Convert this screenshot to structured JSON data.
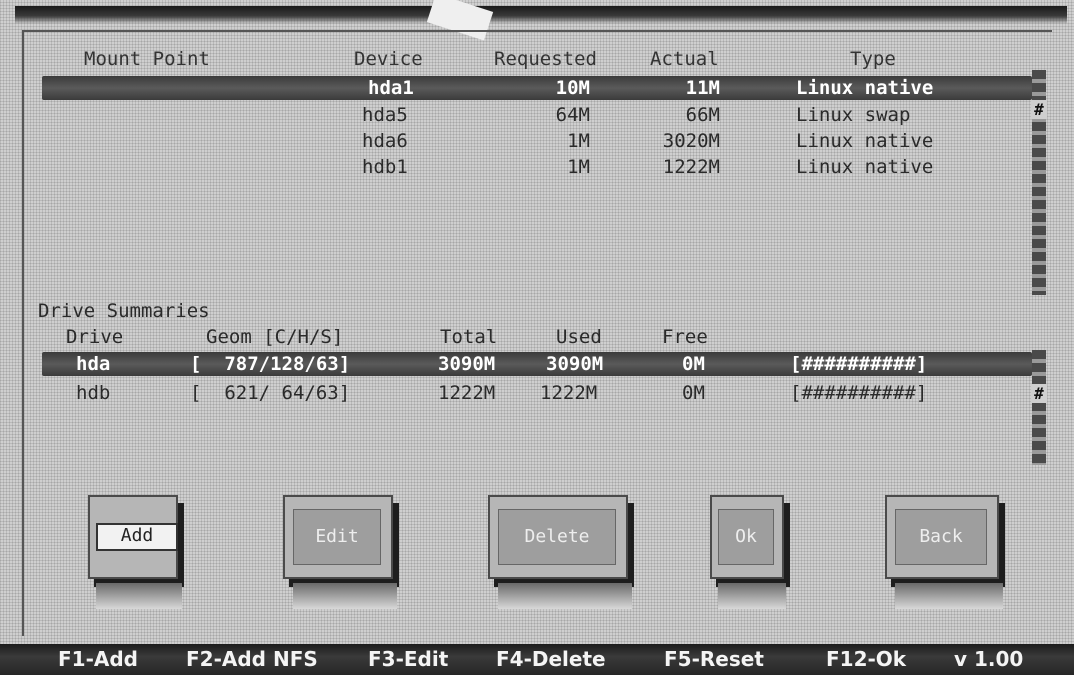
{
  "partition_header": {
    "mount_point": "Mount Point",
    "device": "Device",
    "requested": "Requested",
    "actual": "Actual",
    "type": "Type"
  },
  "partitions": [
    {
      "mount": "",
      "device": "hda1",
      "requested": "10M",
      "actual": "11M",
      "type": "Linux native"
    },
    {
      "mount": "",
      "device": "hda5",
      "requested": "64M",
      "actual": "66M",
      "type": "Linux swap"
    },
    {
      "mount": "",
      "device": "hda6",
      "requested": "1M",
      "actual": "3020M",
      "type": "Linux native"
    },
    {
      "mount": "",
      "device": "hdb1",
      "requested": "1M",
      "actual": "1222M",
      "type": "Linux native"
    }
  ],
  "drive_summaries": {
    "title": "Drive Summaries",
    "header": {
      "drive": "Drive",
      "geom": "Geom [C/H/S]",
      "total": "Total",
      "used": "Used",
      "free": "Free"
    },
    "rows": [
      {
        "drive": "hda",
        "geom": "[  787/128/63]",
        "total": "3090M",
        "used": "3090M",
        "free": "0M",
        "bar": "[##########]"
      },
      {
        "drive": "hdb",
        "geom": "[  621/ 64/63]",
        "total": "1222M",
        "used": "1222M",
        "free": "0M",
        "bar": "[##########]"
      }
    ]
  },
  "buttons": {
    "add": "Add",
    "edit": "Edit",
    "delete": "Delete",
    "ok": "Ok",
    "back": "Back"
  },
  "status_bar": {
    "f1": "F1-Add",
    "f2": "F2-Add NFS",
    "f3": "F3-Edit",
    "f4": "F4-Delete",
    "f5": "F5-Reset",
    "f12": "F12-Ok",
    "version": "v 1.00"
  },
  "scroll_marks": {
    "top": "#",
    "bottom": "#"
  }
}
